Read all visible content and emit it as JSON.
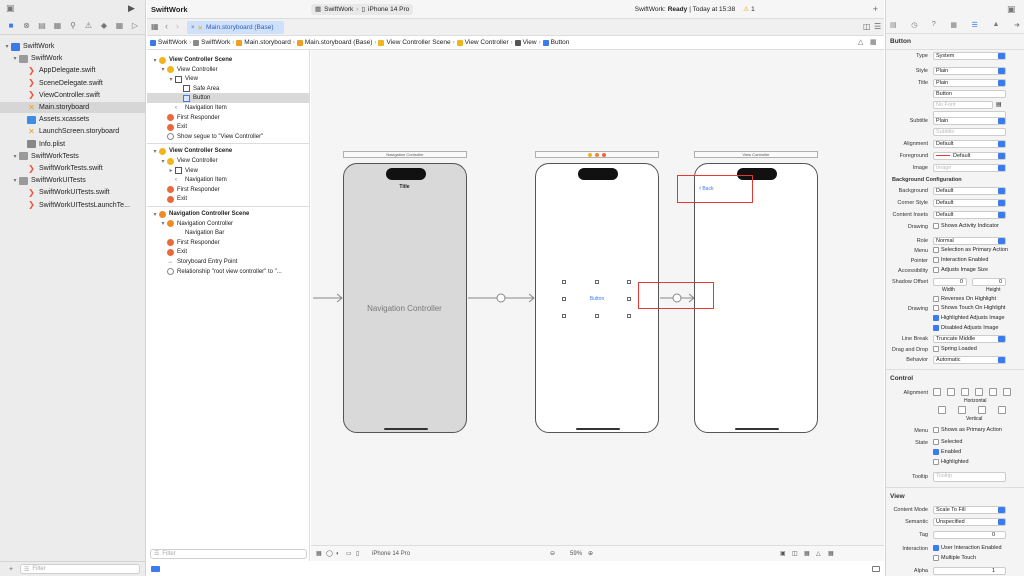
{
  "window": {
    "project_name": "SwiftWork",
    "scheme": "SwiftWork",
    "device": "iPhone 14 Pro",
    "status": "SwiftWork: ",
    "status_bold": "Ready",
    "status_time": " | Today at 15:38",
    "warning_count": "1"
  },
  "tab": {
    "label": "Main.storyboard (Base)"
  },
  "jumpbar": [
    "SwiftWork",
    "SwiftWork",
    "Main.storyboard",
    "Main.storyboard (Base)",
    "View Controller Scene",
    "View Controller",
    "View",
    "Button"
  ],
  "navigator": {
    "items": [
      {
        "label": "SwiftWork",
        "icon": "proj",
        "indent": 0,
        "disclosure": "down"
      },
      {
        "label": "SwiftWork",
        "icon": "folder",
        "indent": 1,
        "disclosure": "down"
      },
      {
        "label": "AppDelegate.swift",
        "icon": "swift",
        "indent": 2,
        "disclosure": ""
      },
      {
        "label": "SceneDelegate.swift",
        "icon": "swift",
        "indent": 2,
        "disclosure": ""
      },
      {
        "label": "ViewController.swift",
        "icon": "swift",
        "indent": 2,
        "disclosure": ""
      },
      {
        "label": "Main.storyboard",
        "icon": "sb",
        "indent": 2,
        "disclosure": "",
        "selected": true
      },
      {
        "label": "Assets.xcassets",
        "icon": "assets",
        "indent": 2,
        "disclosure": ""
      },
      {
        "label": "LaunchScreen.storyboard",
        "icon": "sb",
        "indent": 2,
        "disclosure": ""
      },
      {
        "label": "Info.plist",
        "icon": "plist",
        "indent": 2,
        "disclosure": ""
      },
      {
        "label": "SwiftWorkTests",
        "icon": "folder",
        "indent": 1,
        "disclosure": "down"
      },
      {
        "label": "SwiftWorkTests.swift",
        "icon": "swift",
        "indent": 2,
        "disclosure": ""
      },
      {
        "label": "SwiftWorkUITests",
        "icon": "folder",
        "indent": 1,
        "disclosure": "down"
      },
      {
        "label": "SwiftWorkUITests.swift",
        "icon": "swift",
        "indent": 2,
        "disclosure": ""
      },
      {
        "label": "SwiftWorkUITestsLaunchTe...",
        "icon": "swift",
        "indent": 2,
        "disclosure": ""
      }
    ],
    "filter_placeholder": "Filter"
  },
  "outline": {
    "rows": [
      {
        "label": "View Controller Scene",
        "icon": "y",
        "indent": 0,
        "disclosure": "down",
        "bold": true
      },
      {
        "label": "View Controller",
        "icon": "y",
        "indent": 1,
        "disclosure": "down"
      },
      {
        "label": "View",
        "icon": "sq",
        "indent": 2,
        "disclosure": "down"
      },
      {
        "label": "Safe Area",
        "icon": "sq",
        "indent": 3,
        "disclosure": ""
      },
      {
        "label": "Button",
        "icon": "btn",
        "indent": 3,
        "disclosure": "",
        "selected": true
      },
      {
        "label": "Navigation Item",
        "icon": "lt",
        "indent": 2,
        "disclosure": ""
      },
      {
        "label": "First Responder",
        "icon": "r",
        "indent": 1,
        "disclosure": ""
      },
      {
        "label": "Exit",
        "icon": "r",
        "indent": 1,
        "disclosure": ""
      },
      {
        "label": "Show segue to \"View Controller\"",
        "icon": "seg",
        "indent": 1,
        "disclosure": ""
      },
      {
        "label": "",
        "icon": "",
        "indent": 0,
        "disclosure": "",
        "divider": true
      },
      {
        "label": "View Controller Scene",
        "icon": "y",
        "indent": 0,
        "disclosure": "down",
        "bold": true
      },
      {
        "label": "View Controller",
        "icon": "y",
        "indent": 1,
        "disclosure": "down"
      },
      {
        "label": "View",
        "icon": "sq",
        "indent": 2,
        "disclosure": "right"
      },
      {
        "label": "Navigation Item",
        "icon": "lt",
        "indent": 2,
        "disclosure": ""
      },
      {
        "label": "First Responder",
        "icon": "r",
        "indent": 1,
        "disclosure": ""
      },
      {
        "label": "Exit",
        "icon": "r",
        "indent": 1,
        "disclosure": ""
      },
      {
        "label": "",
        "icon": "",
        "indent": 0,
        "disclosure": "",
        "divider": true
      },
      {
        "label": "Navigation Controller Scene",
        "icon": "o",
        "indent": 0,
        "disclosure": "down",
        "bold": true
      },
      {
        "label": "Navigation Controller",
        "icon": "o",
        "indent": 1,
        "disclosure": "down"
      },
      {
        "label": "Navigation Bar",
        "icon": "",
        "indent": 2,
        "disclosure": ""
      },
      {
        "label": "First Responder",
        "icon": "r",
        "indent": 1,
        "disclosure": ""
      },
      {
        "label": "Exit",
        "icon": "r",
        "indent": 1,
        "disclosure": ""
      },
      {
        "label": "Storyboard Entry Point",
        "icon": "arrow",
        "indent": 1,
        "disclosure": ""
      },
      {
        "label": "Relationship \"root view controller\" to \"...",
        "icon": "seg",
        "indent": 1,
        "disclosure": ""
      }
    ],
    "filter_placeholder": "Filter"
  },
  "canvas": {
    "nav_scene_title": "Navigation Controller",
    "vc_scene_title": "View Controller",
    "nav_bar_title": "Title",
    "nav_controller_label": "Navigation Controller",
    "button_label": "Button",
    "back_label": "Back",
    "zoom": "59%",
    "device": "iPhone 14 Pro",
    "highlight_color": "#e53935",
    "accent_color": "#3a7bf0"
  },
  "inspector": {
    "section_button": "Button",
    "type_label": "Type",
    "type_value": "System",
    "style_label": "Style",
    "style_value": "Plain",
    "title_label": "Title",
    "title_value": "Plain",
    "title_text": "Button",
    "font_placeholder": "No Font",
    "subtitle_label": "Subtitle",
    "subtitle_value": "Plain",
    "subtitle_placeholder": "Subtitle",
    "alignment_label": "Alignment",
    "alignment_value": "Default",
    "foreground_label": "Foreground",
    "foreground_value": "Default",
    "image_label": "Image",
    "image_placeholder": "Image",
    "bg_config": "Background Configuration",
    "background_label": "Background",
    "background_value": "Default",
    "corner_label": "Corner Style",
    "corner_value": "Default",
    "insets_label": "Content Insets",
    "insets_value": "Default",
    "drawing_label": "Drawing",
    "activity_label": "Shows Activity Indicator",
    "role_label": "Role",
    "role_value": "Normal",
    "menu_label": "Menu",
    "menu_check": "Selection as Primary Action",
    "pointer_label": "Pointer",
    "pointer_check": "Interaction Enabled",
    "access_label": "Accessibility",
    "access_check": "Adjusts Image Size",
    "shadow_label": "Shadow Offset",
    "shadow_w": "0",
    "shadow_h": "0",
    "width_label": "Width",
    "height_label": "Height",
    "reverses_check": "Reverses On Highlight",
    "drawing2_label": "Drawing",
    "touch_check": "Shows Touch On Highlight",
    "highlighted_adj": "Highlighted Adjusts Image",
    "disabled_adj": "Disabled Adjusts Image",
    "linebreak_label": "Line Break",
    "linebreak_value": "Truncate Middle",
    "dragdrop_label": "Drag and Drop",
    "dragdrop_check": "Spring Loaded",
    "behavior_label": "Behavior",
    "behavior_value": "Automatic",
    "section_control": "Control",
    "align_label": "Alignment",
    "horizontal_label": "Horizontal",
    "vertical_label": "Vertical",
    "cmenu_label": "Menu",
    "cmenu_check": "Shows as Primary Action",
    "state_label": "State",
    "selected_check": "Selected",
    "enabled_check": "Enabled",
    "highlighted_check": "Highlighted",
    "tooltip_label": "Tooltip",
    "tooltip_placeholder": "Tooltip",
    "section_view": "View",
    "content_mode_label": "Content Mode",
    "content_mode_value": "Scale To Fill",
    "semantic_label": "Semantic",
    "semantic_value": "Unspecified",
    "tag_label": "Tag",
    "tag_value": "0",
    "interaction_label": "Interaction",
    "user_interaction": "User Interaction Enabled",
    "multiple_touch": "Multiple Touch",
    "alpha_label": "Alpha",
    "alpha_value": "1"
  }
}
